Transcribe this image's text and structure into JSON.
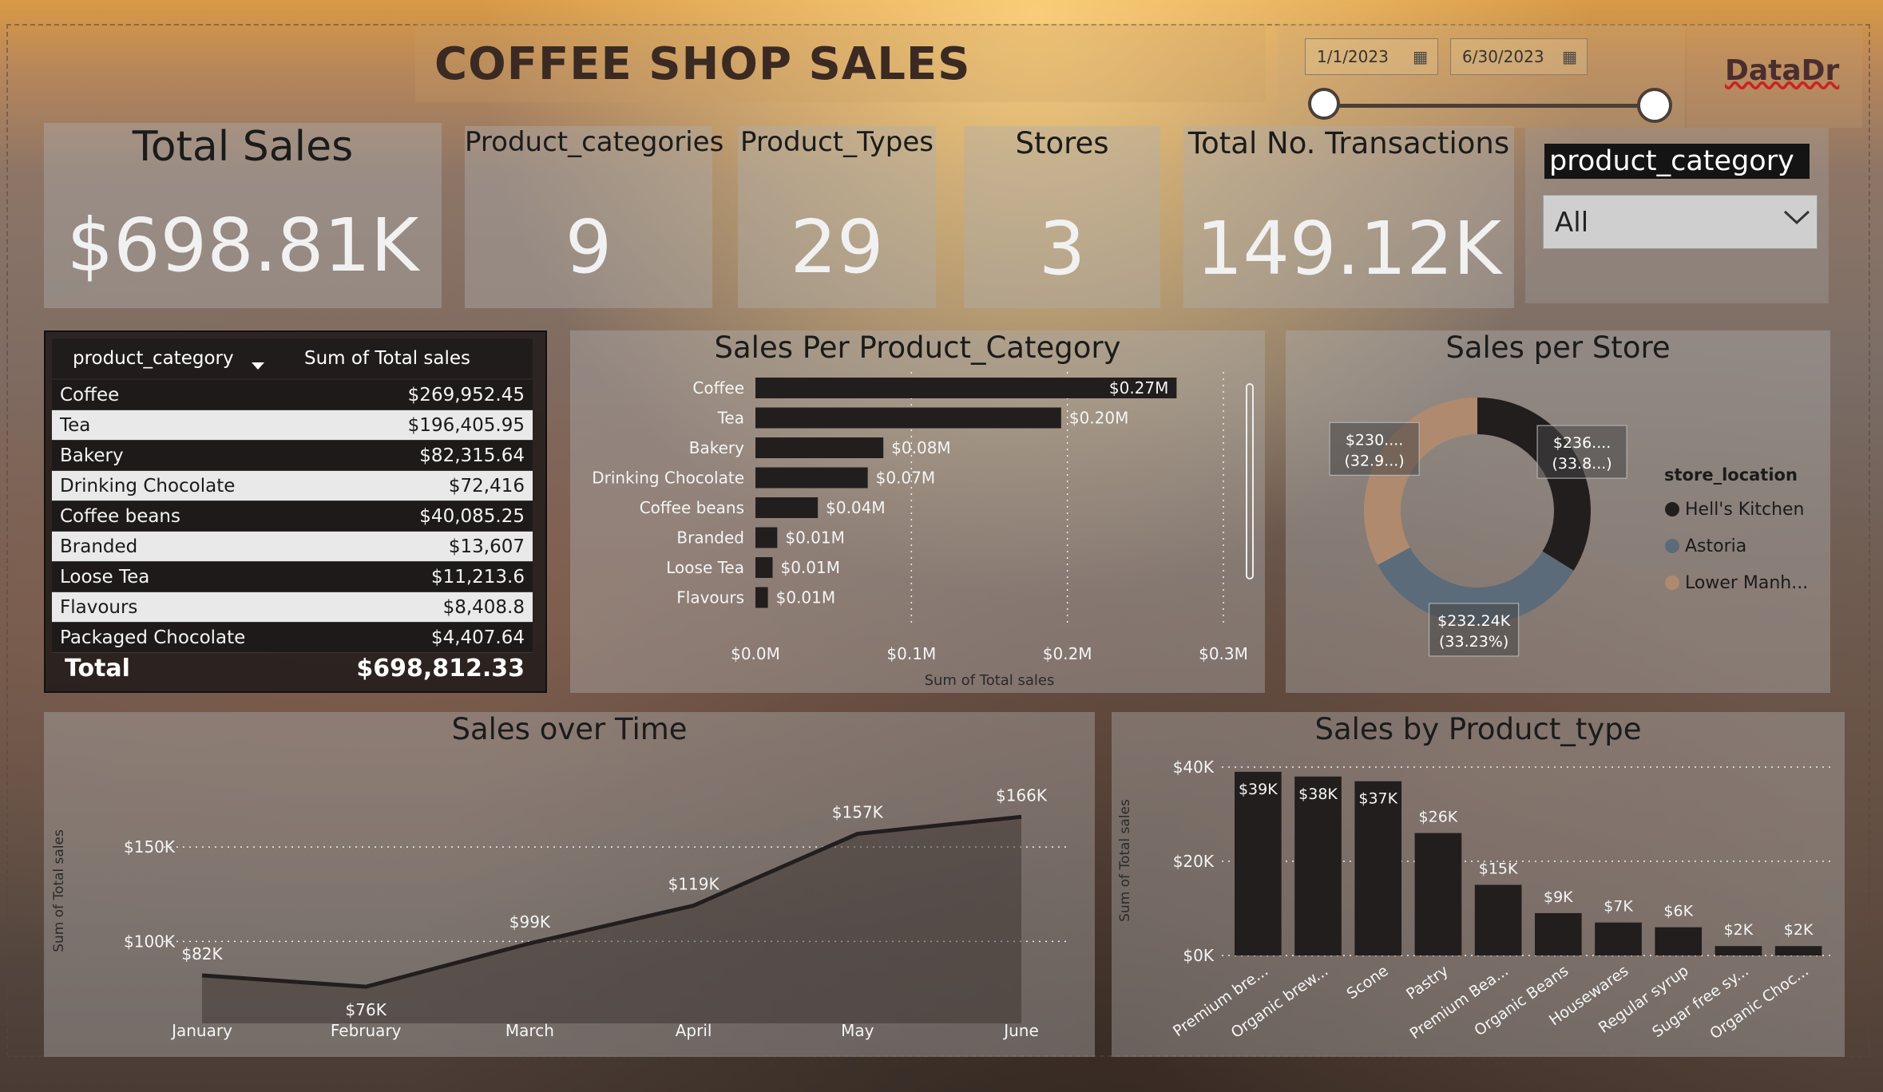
{
  "header": {
    "title": "COFFEE SHOP SALES",
    "brand": "DataDr"
  },
  "date_range": {
    "start": "1/1/2023",
    "end": "6/30/2023"
  },
  "kpis": {
    "total_sales": {
      "label": "Total Sales",
      "value": "$698.81K"
    },
    "product_categories": {
      "label": "Product_categories",
      "value": "9"
    },
    "product_types": {
      "label": "Product_Types",
      "value": "29"
    },
    "stores": {
      "label": "Stores",
      "value": "3"
    },
    "transactions": {
      "label": "Total No. Transactions",
      "value": "149.12K"
    }
  },
  "filter": {
    "label": "product_category",
    "selected": "All"
  },
  "table": {
    "headers": [
      "product_category",
      "Sum of Total sales"
    ],
    "rows": [
      [
        "Coffee",
        "$269,952.45"
      ],
      [
        "Tea",
        "$196,405.95"
      ],
      [
        "Bakery",
        "$82,315.64"
      ],
      [
        "Drinking Chocolate",
        "$72,416"
      ],
      [
        "Coffee beans",
        "$40,085.25"
      ],
      [
        "Branded",
        "$13,607"
      ],
      [
        "Loose Tea",
        "$11,213.6"
      ],
      [
        "Flavours",
        "$8,408.8"
      ],
      [
        "Packaged Chocolate",
        "$4,407.64"
      ]
    ],
    "total_label": "Total",
    "total_value": "$698,812.33"
  },
  "colors": {
    "dark": "#231e1e",
    "astoria": "#5c6b79",
    "lower": "#b08a6e",
    "panel": "#b4b4b4"
  },
  "chart_data": [
    {
      "type": "bar",
      "orientation": "horizontal",
      "title": "Sales Per Product_Category",
      "xlabel": "Sum of Total sales",
      "categories": [
        "Coffee",
        "Tea",
        "Bakery",
        "Drinking Chocolate",
        "Coffee beans",
        "Branded",
        "Loose Tea",
        "Flavours"
      ],
      "values": [
        0.27,
        0.196,
        0.082,
        0.072,
        0.04,
        0.014,
        0.011,
        0.008
      ],
      "data_labels": [
        "$0.27M",
        "$0.20M",
        "$0.08M",
        "$0.07M",
        "$0.04M",
        "$0.01M",
        "$0.01M",
        "$0.01M"
      ],
      "xticks": [
        "$0.0M",
        "$0.1M",
        "$0.2M",
        "$0.3M"
      ],
      "xlim": [
        0,
        0.3
      ],
      "grid": true
    },
    {
      "type": "pie",
      "donut": true,
      "title": "Sales per Store",
      "legend_title": "store_location",
      "legend_placement": "right",
      "labels": [
        "Hell's Kitchen",
        "Astoria",
        "Lower Manh..."
      ],
      "values": [
        236.5,
        232.24,
        230.05
      ],
      "data_labels": [
        [
          "$236....",
          "(33.8...)"
        ],
        [
          "$232.24K",
          "(33.23%)"
        ],
        [
          "$230....",
          "(32.9...)"
        ]
      ]
    },
    {
      "type": "area",
      "title": "Sales over Time",
      "ylabel": "Sum of Total sales",
      "categories": [
        "January",
        "February",
        "March",
        "April",
        "May",
        "June"
      ],
      "values": [
        82,
        76,
        99,
        119,
        157,
        166
      ],
      "data_labels": [
        "$82K",
        "$76K",
        "$99K",
        "$119K",
        "$157K",
        "$166K"
      ],
      "yticks": [
        "$100K",
        "$150K"
      ],
      "ylim": [
        60,
        175
      ],
      "grid": true
    },
    {
      "type": "bar",
      "title": "Sales by Product_type",
      "ylabel": "Sum of Total sales",
      "categories": [
        "Premium bre...",
        "Organic brew...",
        "Scone",
        "Pastry",
        "Premium Bea...",
        "Organic Beans",
        "Housewares",
        "Regular syrup",
        "Sugar free sy...",
        "Organic Choc..."
      ],
      "values": [
        39,
        38,
        37,
        26,
        15,
        9,
        7,
        6,
        2,
        2
      ],
      "data_labels": [
        "$39K",
        "$38K",
        "$37K",
        "$26K",
        "$15K",
        "$9K",
        "$7K",
        "$6K",
        "$2K",
        "$2K"
      ],
      "yticks": [
        "$0K",
        "$20K",
        "$40K"
      ],
      "ylim": [
        0,
        40
      ],
      "grid": true
    }
  ]
}
